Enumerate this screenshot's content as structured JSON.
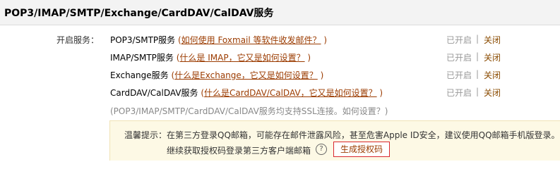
{
  "header": {
    "title": "POP3/IMAP/SMTP/Exchange/CardDAV/CalDAV服务"
  },
  "label": "开启服务：",
  "services": [
    {
      "name": "POP3/SMTP服务",
      "help_prefix": " (",
      "help_link": "如何使用 Foxmail 等软件收发邮件？",
      "help_suffix": " )",
      "status": "已开启",
      "sep": "|",
      "close": "关闭"
    },
    {
      "name": "IMAP/SMTP服务",
      "help_prefix": " (",
      "help_link": "什么是 IMAP，它又是如何设置？",
      "help_suffix": " )",
      "status": "已开启",
      "sep": "|",
      "close": "关闭"
    },
    {
      "name": "Exchange服务",
      "help_prefix": " (",
      "help_link": "什么是Exchange，它又是如何设置？",
      "help_suffix": " )",
      "status": "已开启",
      "sep": "|",
      "close": "关闭"
    },
    {
      "name": "CardDAV/CalDAV服务",
      "help_prefix": " (",
      "help_link": "什么是CardDAV/CalDAV，它又是如何设置？",
      "help_suffix": " )",
      "status": "已开启",
      "sep": "|",
      "close": "关闭"
    }
  ],
  "ssl_note": "(POP3/IMAP/SMTP/CardDAV/CalDAV服务均支持SSL连接。如何设置？)",
  "notice": {
    "label": "温馨提示：",
    "text": "在第三方登录QQ邮箱，可能存在邮件泄露风险，甚至危害Apple ID安全，建议使用QQ邮箱手机版登录。",
    "line2": "继续获取授权码登录第三方客户端邮箱",
    "help_icon": "?",
    "button": "生成授权码"
  }
}
